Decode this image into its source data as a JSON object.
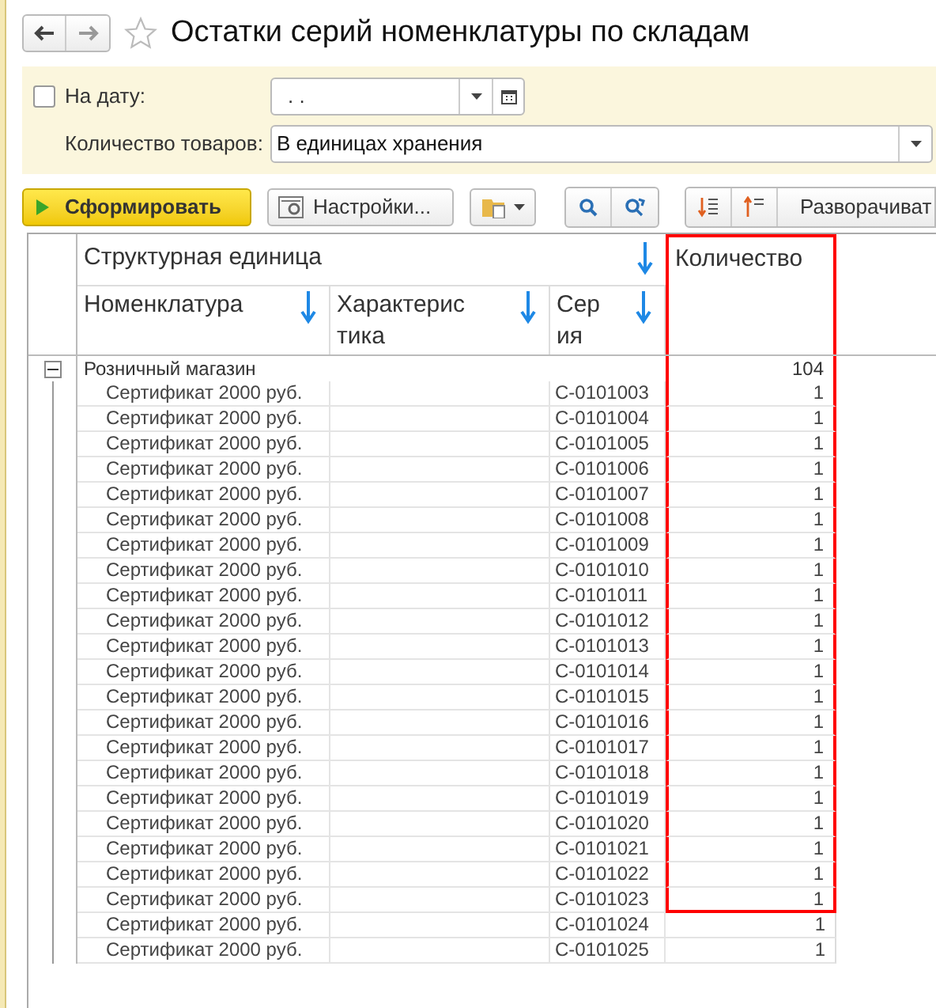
{
  "window": {
    "title": "Остатки серий номенклатуры по складам",
    "favorite": false
  },
  "filters": {
    "date_checkbox": {
      "label": "На дату:",
      "checked": false
    },
    "date_field": {
      "value": ". ."
    },
    "quantity": {
      "label": "Количество товаров:",
      "value": "В единицах хранения"
    }
  },
  "toolbar": {
    "generate": "Сформировать",
    "settings": "Настройки...",
    "expand": "Разворачиват"
  },
  "table": {
    "group_header": "Структурная единица",
    "columns": [
      {
        "label": "Номенклатура"
      },
      {
        "label": "Характерис тика"
      },
      {
        "label": "Сер ия"
      }
    ],
    "quantity_header": {
      "label": "Количество",
      "highlighted": true
    },
    "group": {
      "label": "Розничный магазин",
      "value": "104",
      "expanded": true
    },
    "rows": [
      {
        "name": "Сертификат 2000 руб.",
        "series": "С-0101003",
        "qty": "1",
        "highlighted": true
      },
      {
        "name": "Сертификат 2000 руб.",
        "series": "С-0101004",
        "qty": "1",
        "highlighted": true
      },
      {
        "name": "Сертификат 2000 руб.",
        "series": "С-0101005",
        "qty": "1",
        "highlighted": true
      },
      {
        "name": "Сертификат 2000 руб.",
        "series": "С-0101006",
        "qty": "1",
        "highlighted": true
      },
      {
        "name": "Сертификат 2000 руб.",
        "series": "С-0101007",
        "qty": "1",
        "highlighted": true
      },
      {
        "name": "Сертификат 2000 руб.",
        "series": "С-0101008",
        "qty": "1",
        "highlighted": true
      },
      {
        "name": "Сертификат 2000 руб.",
        "series": "С-0101009",
        "qty": "1",
        "highlighted": true
      },
      {
        "name": "Сертификат 2000 руб.",
        "series": "С-0101010",
        "qty": "1",
        "highlighted": true
      },
      {
        "name": "Сертификат 2000 руб.",
        "series": "С-0101011",
        "qty": "1",
        "highlighted": true
      },
      {
        "name": "Сертификат 2000 руб.",
        "series": "С-0101012",
        "qty": "1",
        "highlighted": true
      },
      {
        "name": "Сертификат 2000 руб.",
        "series": "С-0101013",
        "qty": "1",
        "highlighted": true
      },
      {
        "name": "Сертификат 2000 руб.",
        "series": "С-0101014",
        "qty": "1",
        "highlighted": true
      },
      {
        "name": "Сертификат 2000 руб.",
        "series": "С-0101015",
        "qty": "1",
        "highlighted": true
      },
      {
        "name": "Сертификат 2000 руб.",
        "series": "С-0101016",
        "qty": "1",
        "highlighted": true
      },
      {
        "name": "Сертификат 2000 руб.",
        "series": "С-0101017",
        "qty": "1",
        "highlighted": true
      },
      {
        "name": "Сертификат 2000 руб.",
        "series": "С-0101018",
        "qty": "1",
        "highlighted": true
      },
      {
        "name": "Сертификат 2000 руб.",
        "series": "С-0101019",
        "qty": "1",
        "highlighted": true
      },
      {
        "name": "Сертификат 2000 руб.",
        "series": "С-0101020",
        "qty": "1",
        "highlighted": true
      },
      {
        "name": "Сертификат 2000 руб.",
        "series": "С-0101021",
        "qty": "1",
        "highlighted": true
      },
      {
        "name": "Сертификат 2000 руб.",
        "series": "С-0101022",
        "qty": "1",
        "highlighted": true
      },
      {
        "name": "Сертификат 2000 руб.",
        "series": "С-0101023",
        "qty": "1",
        "highlighted": true
      },
      {
        "name": "Сертификат 2000 руб.",
        "series": "С-0101024",
        "qty": "1",
        "highlighted": false
      },
      {
        "name": "Сертификат 2000 руб.",
        "series": "С-0101025",
        "qty": "1",
        "highlighted": false
      }
    ]
  }
}
